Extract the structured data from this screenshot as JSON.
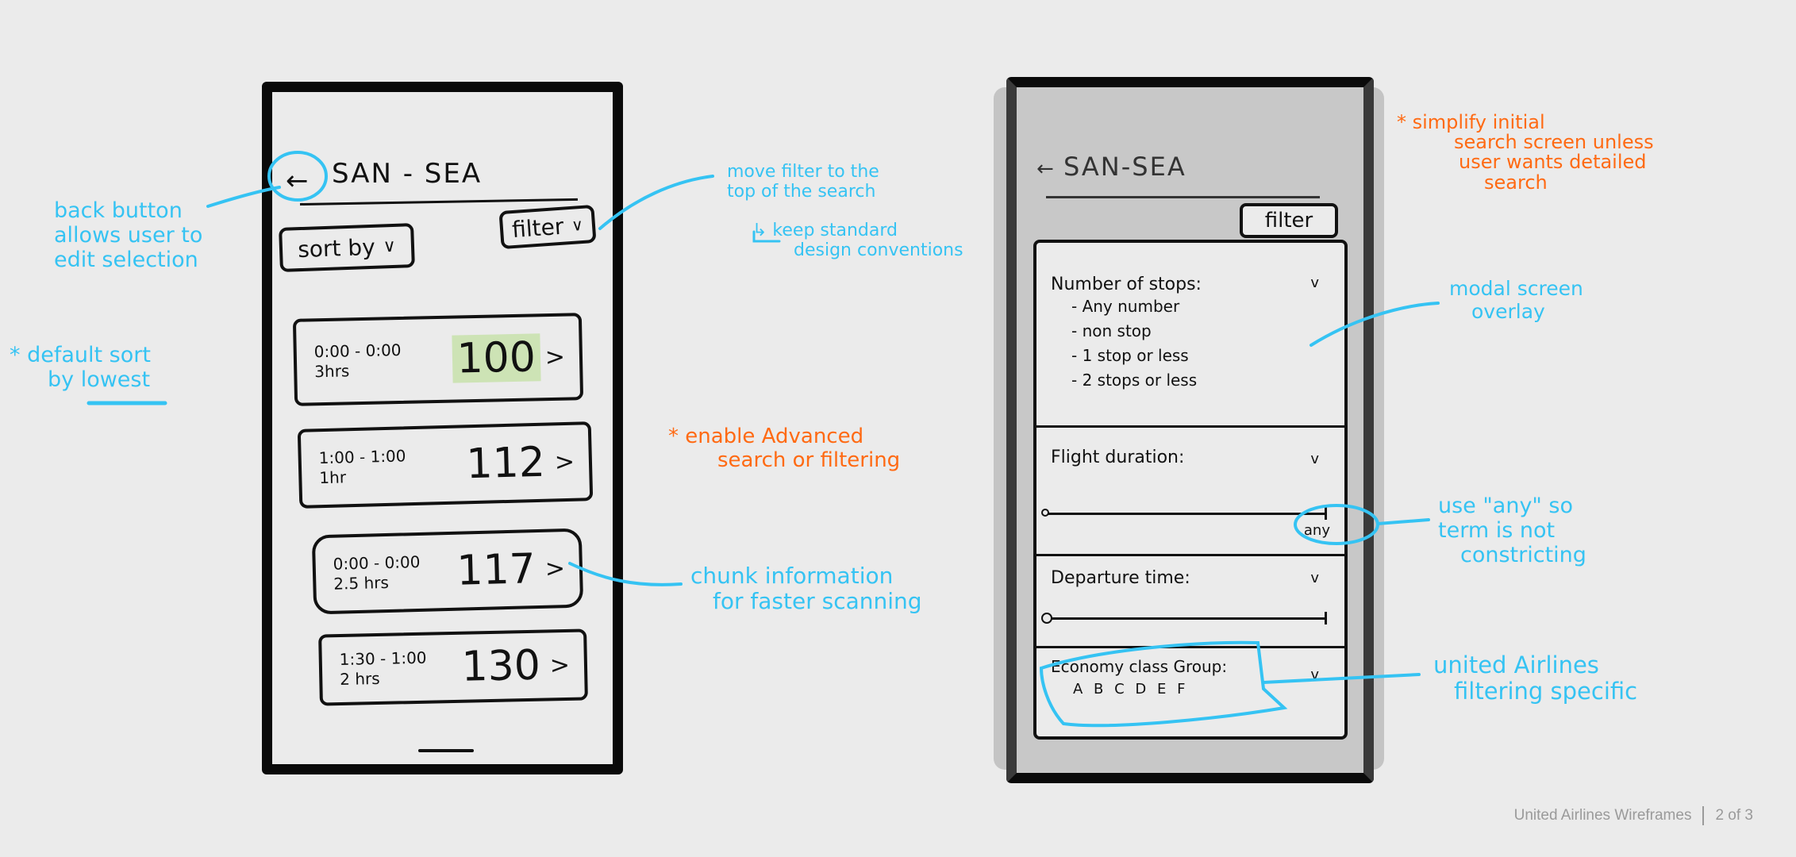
{
  "colors": {
    "background": "#ebebeb",
    "annotation_blue": "#35c3f3",
    "annotation_orange": "#ff6a13",
    "ink": "#111111",
    "highlight_green": "#cde3b5",
    "overlay_gray": "#c8c8c8"
  },
  "left_phone": {
    "back_icon": "left-arrow",
    "route": "SAN - SEA",
    "sort_button": {
      "label": "sort by",
      "icon": "chevron-down"
    },
    "filter_button": {
      "label": "filter",
      "icon": "chevron-down"
    },
    "flights": [
      {
        "times": "0:00 - 0:00",
        "duration": "3hrs",
        "price": "100",
        "highlighted": true
      },
      {
        "times": "1:00 - 1:00",
        "duration": "1hr",
        "price": "112",
        "highlighted": false
      },
      {
        "times": "0:00 - 0:00",
        "duration": "2.5 hrs",
        "price": "117",
        "highlighted": false
      },
      {
        "times": "1:30 - 1:00",
        "duration": "2 hrs",
        "price": "130",
        "highlighted": false
      }
    ],
    "chevron": ">"
  },
  "right_phone": {
    "back_icon": "left-arrow",
    "route": "SAN-SEA",
    "filter_tab": "filter",
    "modal": {
      "stops": {
        "label": "Number of stops:",
        "options": [
          "- Any number",
          "- non stop",
          "- 1 stop or less",
          "- 2 stops or less"
        ]
      },
      "duration": {
        "label": "Flight duration:",
        "value_label": "any"
      },
      "departure": {
        "label": "Departure time:"
      },
      "economy": {
        "label": "Economy class Group:",
        "groups": "A B C D E F"
      },
      "chevron": "v"
    }
  },
  "annotations": {
    "back_button": [
      "back button",
      "allows user to",
      "edit selection"
    ],
    "default_sort": [
      "* default sort",
      "by lowest"
    ],
    "move_filter": [
      "move filter to the",
      "top of the search"
    ],
    "keep_standard": [
      "↳ keep standard",
      "design conventions"
    ],
    "advanced_search": [
      "* enable Advanced",
      "search or filtering"
    ],
    "chunk_info": [
      "chunk information",
      "for faster scanning"
    ],
    "simplify": [
      "* simplify initial",
      "search screen unless",
      "user wants detailed",
      "search"
    ],
    "modal_overlay": [
      "modal screen",
      "overlay"
    ],
    "use_any": [
      "use \"any\" so",
      "term is not",
      "constricting"
    ],
    "united_specific": [
      "united Airlines",
      "filtering specific"
    ]
  },
  "footer": {
    "title": "United Airlines Wireframes",
    "page": "2 of 3"
  }
}
